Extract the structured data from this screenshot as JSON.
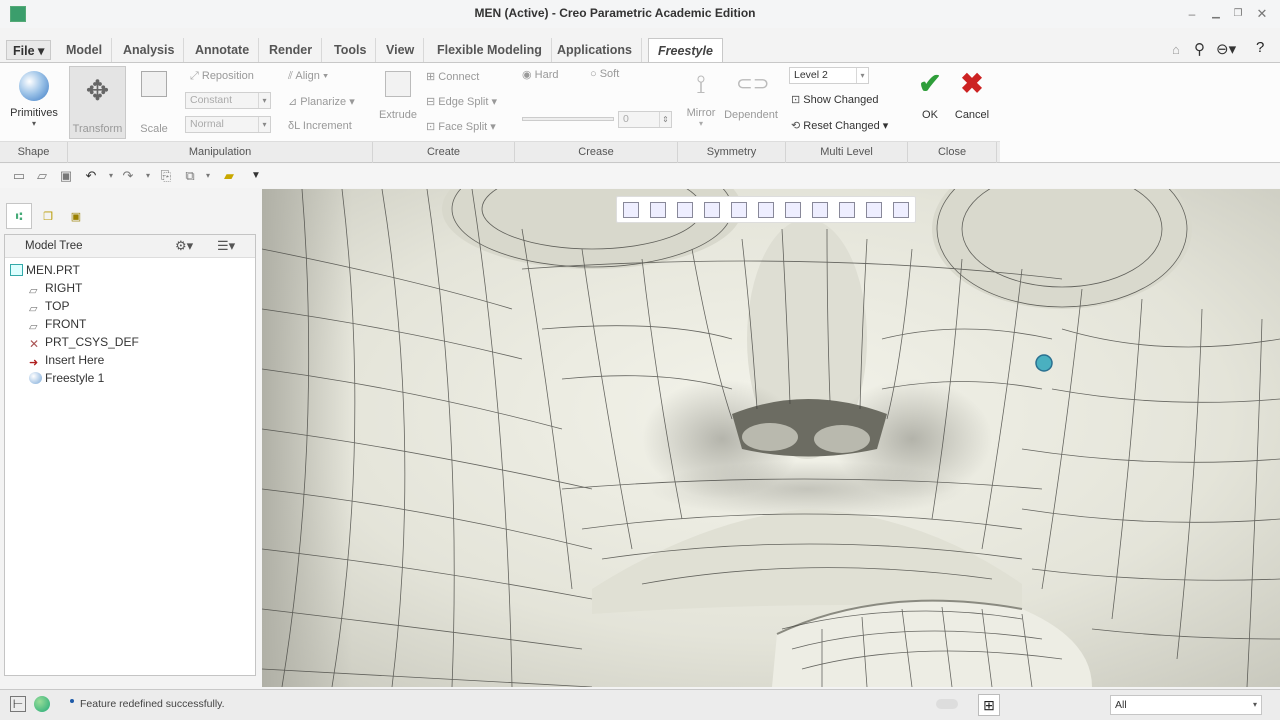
{
  "window": {
    "title": "MEN (Active) - Creo Parametric Academic Edition"
  },
  "tabs": [
    "Model",
    "Analysis",
    "Annotate",
    "Render",
    "Tools",
    "View",
    "Flexible Modeling",
    "Applications"
  ],
  "file_tab": "File",
  "active_tab": "Freestyle",
  "ribbon": {
    "primitives": "Primitives",
    "transform": "Transform",
    "scale": "Scale",
    "reposition": "Reposition",
    "constant": "Constant",
    "normal": "Normal",
    "align": "Align",
    "planarize": "Planarize",
    "increment": "Increment",
    "extrude": "Extrude",
    "connect": "Connect",
    "edge_split": "Edge Split",
    "face_split": "Face Split",
    "hard": "Hard",
    "soft": "Soft",
    "crease_value": "0",
    "mirror": "Mirror",
    "dependent": "Dependent",
    "level": "Level 2",
    "show_changed": "Show Changed",
    "reset_changed": "Reset Changed",
    "ok": "OK",
    "cancel": "Cancel"
  },
  "groups": [
    "Shape",
    "Manipulation",
    "Create",
    "Crease",
    "Symmetry",
    "Multi Level",
    "Close"
  ],
  "model_tree": {
    "title": "Model Tree",
    "items": [
      "MEN.PRT",
      "RIGHT",
      "TOP",
      "FRONT",
      "PRT_CSYS_DEF",
      "Insert Here",
      "Freestyle 1"
    ]
  },
  "status": {
    "message": "Feature redefined successfully.",
    "filter": "All"
  },
  "colors": {
    "accent": "#3a79c4",
    "ok": "#2e9e3a",
    "cancel": "#cc2222"
  }
}
